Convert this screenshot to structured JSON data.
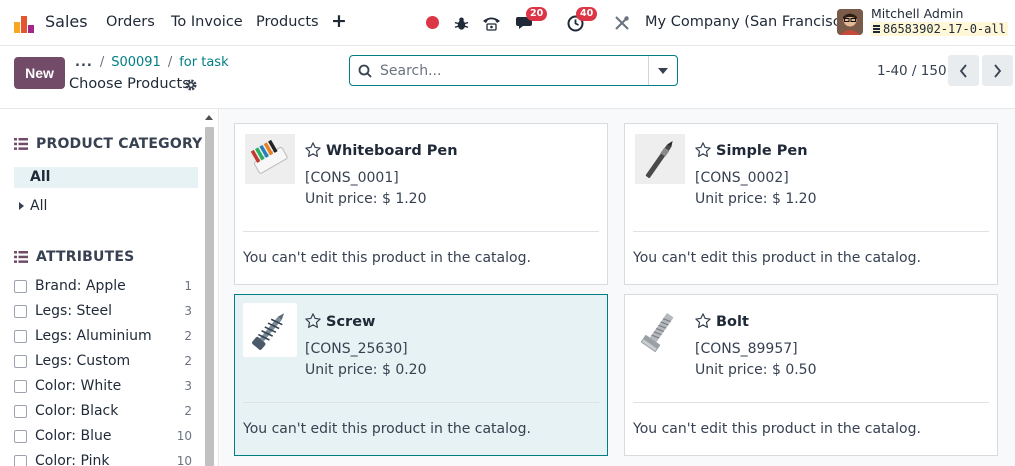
{
  "navbar": {
    "app_name": "Sales",
    "menu": [
      "Orders",
      "To Invoice",
      "Products"
    ],
    "discuss_badge": "20",
    "activity_badge": "40",
    "company": "My Company (San Francisco)",
    "user_name": "Mitchell Admin",
    "db_name": "86583902-17-0-all",
    "icons": [
      "sales-app-icon",
      "plus-icon",
      "record-dot-icon",
      "bug-icon",
      "phone-icon",
      "chat-icon",
      "clock-icon",
      "tools-icon"
    ]
  },
  "control": {
    "new_label": "New",
    "breadcrumb_dots": "...",
    "breadcrumb": [
      "S00091",
      "for task"
    ],
    "title": "Choose Products",
    "search_placeholder": "Search...",
    "pager": "1-40 / 150"
  },
  "sidebar": {
    "category_heading": "PRODUCT CATEGORY",
    "category_all_active": "All",
    "category_all_child": "All",
    "attributes_heading": "ATTRIBUTES",
    "attributes": [
      {
        "label": "Brand: Apple",
        "count": "1"
      },
      {
        "label": "Legs: Steel",
        "count": "3"
      },
      {
        "label": "Legs: Aluminium",
        "count": "2"
      },
      {
        "label": "Legs: Custom",
        "count": "2"
      },
      {
        "label": "Color: White",
        "count": "3"
      },
      {
        "label": "Color: Black",
        "count": "2"
      },
      {
        "label": "Color: Blue",
        "count": "10"
      },
      {
        "label": "Color: Pink",
        "count": "10"
      }
    ]
  },
  "products": [
    {
      "name": "Whiteboard Pen",
      "code": "[CONS_0001]",
      "price": "Unit price: $ 1.20",
      "note": "You can't edit this product in the catalog."
    },
    {
      "name": "Simple Pen",
      "code": "[CONS_0002]",
      "price": "Unit price: $ 1.20",
      "note": "You can't edit this product in the catalog."
    },
    {
      "name": "Screw",
      "code": "[CONS_25630]",
      "price": "Unit price: $ 0.20",
      "note": "You can't edit this product in the catalog."
    },
    {
      "name": "Bolt",
      "code": "[CONS_89957]",
      "price": "Unit price: $ 0.50",
      "note": "You can't edit this product in the catalog."
    }
  ],
  "colors": {
    "brand": "#714B67",
    "accent": "#017e84",
    "badge": "#dc3545",
    "selected_bg": "#e6f2f3"
  }
}
